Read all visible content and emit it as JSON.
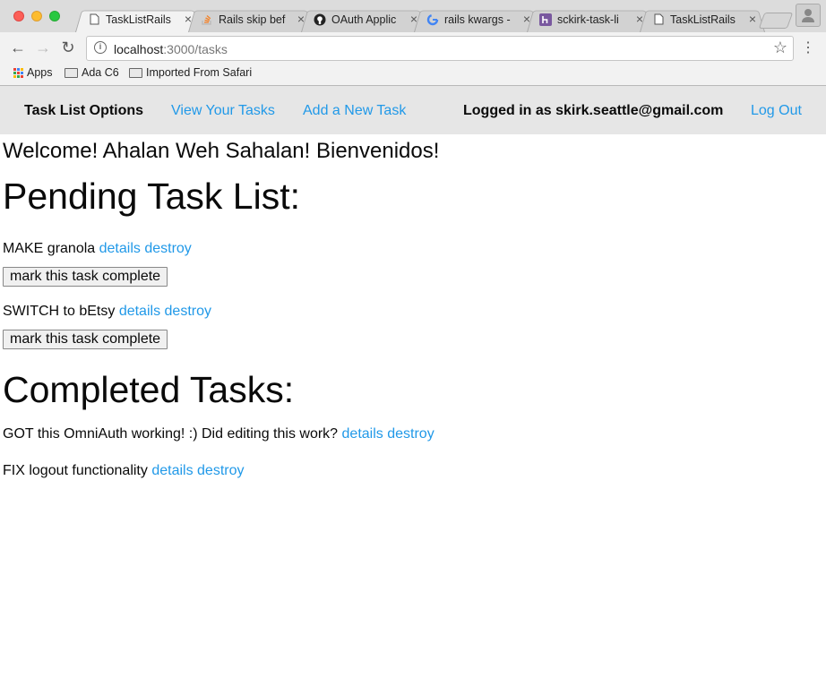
{
  "browser": {
    "tabs": [
      {
        "title": "TaskListRails",
        "icon": "document-icon",
        "active": true
      },
      {
        "title": "Rails skip bef",
        "icon": "stackoverflow-icon",
        "active": false
      },
      {
        "title": "OAuth Applic",
        "icon": "github-icon",
        "active": false
      },
      {
        "title": "rails kwargs -",
        "icon": "google-icon",
        "active": false
      },
      {
        "title": "sckirk-task-li",
        "icon": "heroku-icon",
        "active": false
      },
      {
        "title": "TaskListRails",
        "icon": "document-icon",
        "active": false
      }
    ],
    "url_host": "localhost",
    "url_rest": ":3000/tasks",
    "bookmarks": [
      {
        "label": "Apps",
        "icon": "apps-grid-icon"
      },
      {
        "label": "Ada C6",
        "icon": "folder-icon"
      },
      {
        "label": "Imported From Safari",
        "icon": "folder-icon"
      }
    ]
  },
  "nav": {
    "brand": "Task List Options",
    "view_tasks": "View Your Tasks",
    "add_task": "Add a New Task",
    "logged_in": "Logged in as skirk.seattle@gmail.com",
    "logout": "Log Out"
  },
  "welcome": "Welcome! Ahalan Weh Sahalan! Bienvenidos!",
  "pending": {
    "heading": "Pending Task List:",
    "tasks": [
      {
        "name": "MAKE granola",
        "details": "details",
        "destroy": "destroy",
        "button": "mark this task complete"
      },
      {
        "name": "SWITCH to bEtsy",
        "details": "details",
        "destroy": "destroy",
        "button": "mark this task complete"
      }
    ]
  },
  "completed": {
    "heading": "Completed Tasks:",
    "tasks": [
      {
        "name": "GOT this OmniAuth working! :) Did editing this work?",
        "details": "details",
        "destroy": "destroy"
      },
      {
        "name": "FIX logout functionality",
        "details": "details",
        "destroy": "destroy"
      }
    ]
  },
  "colors": {
    "link": "#2199e8",
    "topbar": "#e6e6e6"
  }
}
